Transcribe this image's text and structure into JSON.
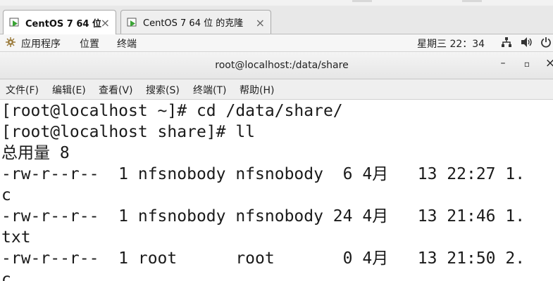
{
  "tabs": [
    {
      "label": "CentOS 7 64 位",
      "active": true
    },
    {
      "label": "CentOS 7 64 位 的克隆",
      "active": false
    }
  ],
  "tab_close_glyph": "×",
  "gnome_bar": {
    "applications": "应用程序",
    "places": "位置",
    "terminal": "终端",
    "clock": "星期三 22：34",
    "icons": [
      "network-icon",
      "volume-icon",
      "power-icon"
    ]
  },
  "window": {
    "title": "root@localhost:/data/share",
    "minimize": "–",
    "maximize": "▫",
    "close": "×"
  },
  "menu": [
    "文件(F)",
    "编辑(E)",
    "查看(V)",
    "搜索(S)",
    "终端(T)",
    "帮助(H)"
  ],
  "terminal_lines": [
    "[root@localhost ~]# cd /data/share/",
    "[root@localhost share]# ll",
    "总用量 8",
    "-rw-r--r--  1 nfsnobody nfsnobody  6 4月   13 22:27 1.",
    "c",
    "-rw-r--r--  1 nfsnobody nfsnobody 24 4月   13 21:46 1.",
    "txt",
    "-rw-r--r--  1 root      root       0 4月   13 21:50 2.",
    "c"
  ],
  "colors": {
    "vm_icon_green": "#3aa335",
    "background": "#ffffff",
    "text": "#1a1a1a"
  }
}
